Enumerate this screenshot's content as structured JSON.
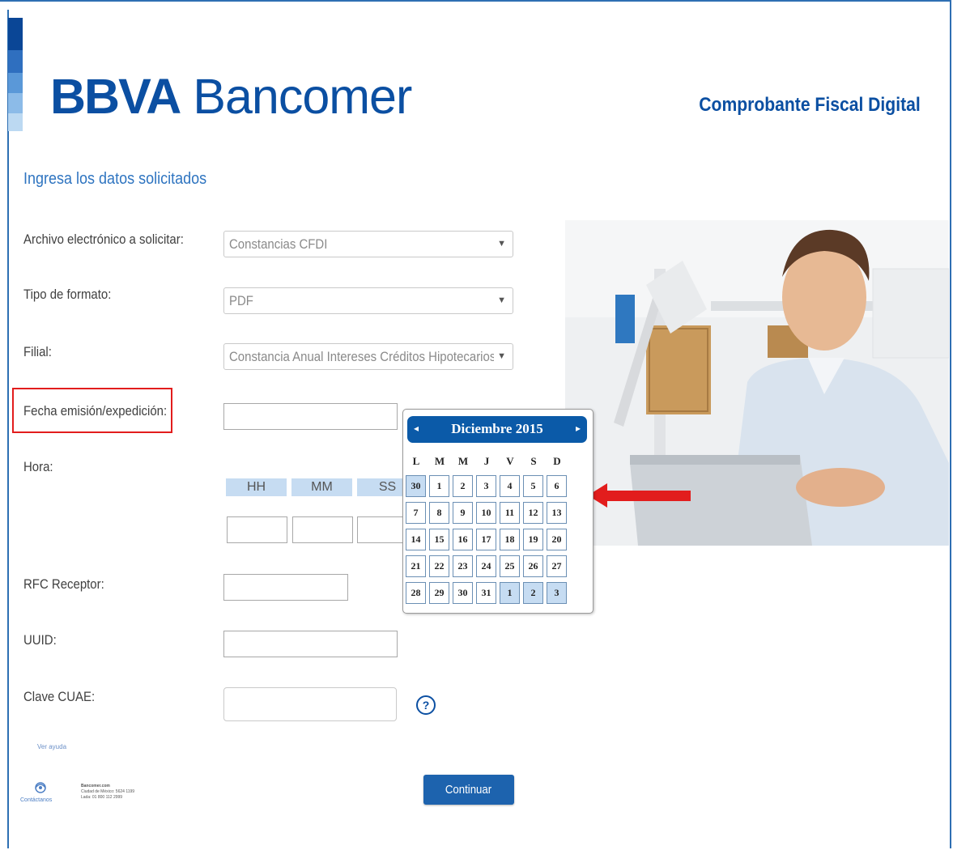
{
  "header": {
    "logo_bold": "BBVA",
    "logo_light": "Bancomer",
    "title": "Comprobante Fiscal Digital"
  },
  "form": {
    "subtitle": "Ingresa los datos solicitados",
    "archivo": {
      "label": "Archivo electrónico a solicitar:",
      "value": "Constancias CFDI"
    },
    "formato": {
      "label": "Tipo de formato:",
      "value": "PDF"
    },
    "filial": {
      "label": "Filial:",
      "value": "Constancia Anual Intereses Créditos Hipotecarios"
    },
    "fecha": {
      "label": "Fecha emisión/expedición:",
      "value": ""
    },
    "hora": {
      "label": "Hora:",
      "hh": "HH",
      "mm": "MM",
      "ss": "SS"
    },
    "rfc": {
      "label": "RFC Receptor:"
    },
    "uuid": {
      "label": "UUID:"
    },
    "cuae": {
      "label": "Clave CUAE:"
    },
    "help_symbol": "?"
  },
  "calendar": {
    "month_title": "Diciembre 2015",
    "prev_icon": "◂",
    "next_icon": "▸",
    "weekdays": [
      "L",
      "M",
      "M",
      "J",
      "V",
      "S",
      "D"
    ],
    "weeks": [
      [
        "30",
        "1",
        "2",
        "3",
        "4",
        "5",
        "6"
      ],
      [
        "7",
        "8",
        "9",
        "10",
        "11",
        "12",
        "13"
      ],
      [
        "14",
        "15",
        "16",
        "17",
        "18",
        "19",
        "20"
      ],
      [
        "21",
        "22",
        "23",
        "24",
        "25",
        "26",
        "27"
      ],
      [
        "28",
        "29",
        "30",
        "31",
        "1",
        "2",
        "3"
      ]
    ],
    "other_month_days": [
      [
        0,
        0
      ],
      [
        4,
        4
      ],
      [
        4,
        5
      ],
      [
        4,
        6
      ]
    ]
  },
  "footer": {
    "tiny_link": "Ver ayuda",
    "contact_label": "Contáctanos",
    "contact_lines": [
      "Bancomer.com",
      "Ciudad de México: 5624 1199",
      "Lada: 01 800 112 2999"
    ],
    "continue_label": "Continuar"
  },
  "colors": {
    "brand_blue": "#0b4fa2",
    "calendar_header": "#0b5aa8",
    "highlight_red": "#e21d1d"
  },
  "icons": {
    "dropdown": "chevron-down-icon",
    "help": "help-circle-icon",
    "pointer": "red-arrow-left-icon",
    "contact": "contact-phone-icon"
  }
}
